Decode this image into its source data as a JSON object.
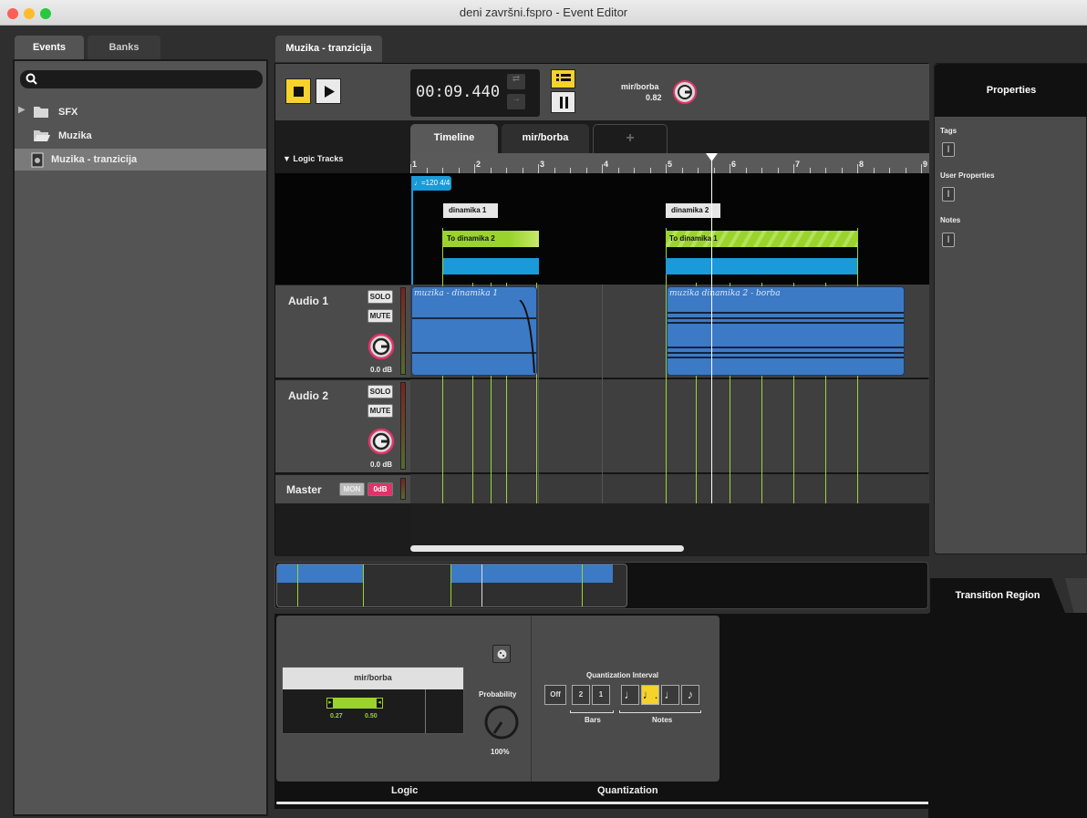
{
  "window": {
    "title": "deni završni.fspro - Event Editor"
  },
  "browser": {
    "tabs": [
      "Events",
      "Banks"
    ],
    "search_placeholder": "",
    "items": [
      {
        "label": "SFX",
        "type": "folder"
      },
      {
        "label": "Muzika",
        "type": "folder-open"
      },
      {
        "label": "Muzika - tranzicija",
        "type": "event"
      }
    ]
  },
  "editor": {
    "tab_label": "Muzika - tranzicija",
    "time": "00:09.440",
    "parameter": {
      "name": "mir/borba",
      "value": "0.82"
    },
    "tabs": [
      "Timeline",
      "mir/borba",
      "+"
    ],
    "logic_tracks_label": "▼ Logic Tracks",
    "ruler": [
      "1",
      "2",
      "3",
      "4",
      "5",
      "6",
      "7",
      "8",
      "9"
    ],
    "tempo_marker": "♩=120 4/4",
    "markers": [
      "dinamika 1",
      "dinamika 2"
    ],
    "transitions": [
      "To dinamika 2",
      "To dinamika 1"
    ],
    "tracks": [
      {
        "name": "Audio 1",
        "solo": "SOLO",
        "mute": "MUTE",
        "volume": "0.0 dB",
        "clips": [
          "muzika - dinamika 1",
          "muzika dinamika 2 - borba"
        ]
      },
      {
        "name": "Audio 2",
        "solo": "SOLO",
        "mute": "MUTE",
        "volume": "0.0 dB"
      }
    ],
    "master": {
      "name": "Master",
      "mon": "MON",
      "level": "0dB"
    }
  },
  "properties": {
    "title": "Properties",
    "sections": [
      "Tags",
      "User Properties",
      "Notes"
    ]
  },
  "transition_region": {
    "tab_label": "Transition Region",
    "logic": {
      "title": "Logic",
      "parameter": "mir/borba",
      "range_min": "0.27",
      "range_max": "0.50",
      "probability_label": "Probability",
      "probability_value": "100%"
    },
    "quantization": {
      "title": "Quantization",
      "interval_label": "Quantization Interval",
      "buttons": [
        "Off",
        "2",
        "1"
      ],
      "bars_label": "Bars",
      "notes_label": "Notes",
      "selected_note_index": 1
    }
  },
  "colors": {
    "accent_yellow": "#f5d32a",
    "transition_green": "#9ad32e",
    "clip_blue": "#3d7ac5",
    "marker_blue": "#1a9ad8"
  }
}
